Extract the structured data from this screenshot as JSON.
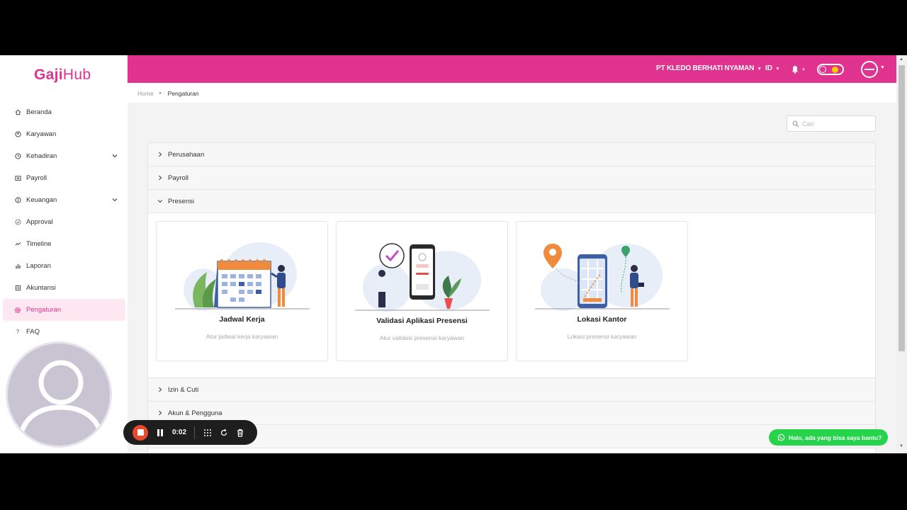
{
  "app": {
    "logo_text_bold": "Gaji",
    "logo_text_light": "Hub"
  },
  "sidebar": {
    "items": [
      {
        "label": "Beranda",
        "icon": "home-icon",
        "has_submenu": false
      },
      {
        "label": "Karyawan",
        "icon": "users-icon",
        "has_submenu": false
      },
      {
        "label": "Kehadiran",
        "icon": "clock-icon",
        "has_submenu": true
      },
      {
        "label": "Payroll",
        "icon": "payroll-icon",
        "has_submenu": false
      },
      {
        "label": "Keuangan",
        "icon": "finance-icon",
        "has_submenu": true
      },
      {
        "label": "Approval",
        "icon": "check-circle-icon",
        "has_submenu": false
      },
      {
        "label": "Timeline",
        "icon": "line-chart-icon",
        "has_submenu": false
      },
      {
        "label": "Laporan",
        "icon": "bar-chart-icon",
        "has_submenu": false
      },
      {
        "label": "Akuntansi",
        "icon": "book-icon",
        "has_submenu": false
      },
      {
        "label": "Pengaturan",
        "icon": "gear-icon",
        "has_submenu": false,
        "active": true
      },
      {
        "label": "FAQ",
        "icon": "question-icon",
        "has_submenu": false
      }
    ]
  },
  "topbar": {
    "company": "PT KLEDO BERHATI NYAMAN",
    "language": "ID",
    "bg_color": "#e0328f"
  },
  "breadcrumb": {
    "home": "Home",
    "current": "Pengaturan"
  },
  "search": {
    "placeholder": "Cari",
    "value": ""
  },
  "panels": [
    {
      "label": "Perusahaan",
      "expanded": false
    },
    {
      "label": "Payroll",
      "expanded": false
    },
    {
      "label": "Presensi",
      "expanded": true
    },
    {
      "label": "Izin & Cuti",
      "expanded": false
    },
    {
      "label": "Akun & Pengguna",
      "expanded": false
    }
  ],
  "presensi_cards": [
    {
      "title": "Jadwal Kerja",
      "description": "Atur jadwal kerja karyawan",
      "illustration": "calendar-illustration"
    },
    {
      "title": "Validasi Aplikasi Presensi",
      "description": "Atur validasi presensi karyawan",
      "illustration": "phone-verify-illustration"
    },
    {
      "title": "Lokasi Kantor",
      "description": "Lokasi presensi karyawan",
      "illustration": "map-location-illustration"
    }
  ],
  "recorder": {
    "time": "0:02"
  },
  "help": {
    "whatsapp_label": "Halo, ada yang bisa saya bantu?"
  },
  "colors": {
    "brand": "#e0328f",
    "active_bg": "#fde8f1",
    "whatsapp": "#25d44a",
    "record": "#e8492f"
  }
}
